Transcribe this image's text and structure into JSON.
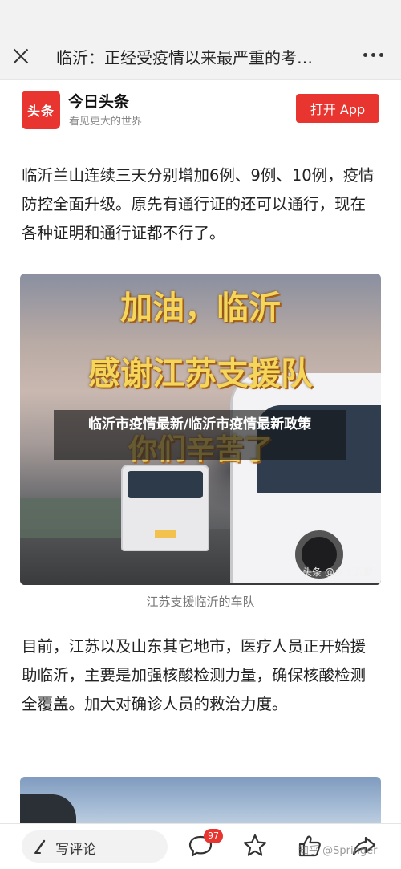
{
  "nav": {
    "title": "临沂：正经受疫情以来最严重的考…"
  },
  "header": {
    "logo_text": "头条",
    "app_name": "今日头条",
    "slogan": "看见更大的世界",
    "open_app_label": "打开 App",
    "accent_color": "#e8352f"
  },
  "article": {
    "paragraph1": "临沂兰山连续三天分别增加6例、9例、10例，疫情防控全面升级。原先有通行证的还可以通行，现在各种证明和通行证都不行了。",
    "image1": {
      "caption_line1": "加油，临沂",
      "caption_line2": "感谢江苏支援队",
      "caption_line3": "你们辛苦了",
      "watermark": "头条 @乡土沂蒙",
      "description_caption": "江苏支援临沂的车队"
    },
    "overlay_title": "临沂市疫情最新/临沂市疫情最新政策",
    "paragraph2": "目前，江苏以及山东其它地市，医疗人员正开始援助临沂，主要是加强核酸检测力量，确保核酸检测全覆盖。加大对确诊人员的救治力度。"
  },
  "bottom_bar": {
    "comment_label": "写评论",
    "comment_count": "97",
    "watermark": "知乎 @Springer"
  },
  "icons": {
    "close": "close-icon",
    "more": "more-dots-icon",
    "pen": "pen-icon",
    "comment": "comment-bubble-icon",
    "favorite": "star-icon",
    "like": "thumbs-up-icon",
    "share": "share-icon"
  }
}
